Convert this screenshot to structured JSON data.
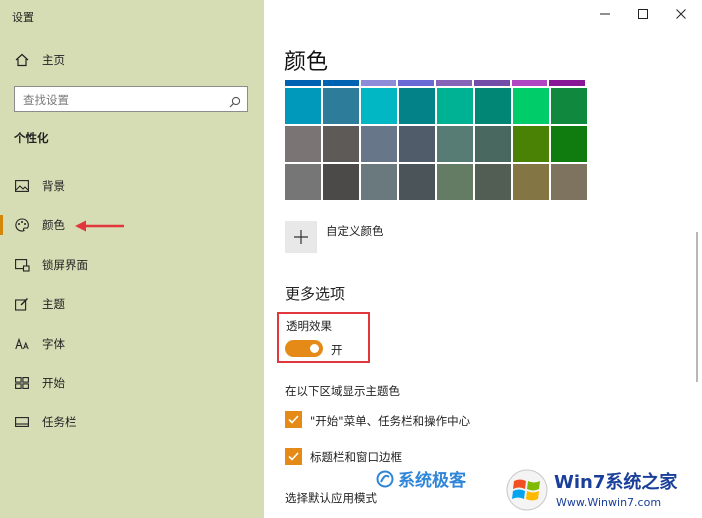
{
  "window": {
    "title": "设置",
    "minimize_glyph": "—",
    "maximize_glyph": "☐",
    "close_glyph": "✕"
  },
  "sidebar": {
    "home_label": "主页",
    "search_placeholder": "查找设置",
    "section": "个性化",
    "items": [
      {
        "label": "背景",
        "icon": "picture-icon"
      },
      {
        "label": "颜色",
        "icon": "palette-icon",
        "selected": true
      },
      {
        "label": "锁屏界面",
        "icon": "lock-screen-icon"
      },
      {
        "label": "主题",
        "icon": "theme-brush-icon"
      },
      {
        "label": "字体",
        "icon": "font-icon"
      },
      {
        "label": "开始",
        "icon": "start-grid-icon"
      },
      {
        "label": "任务栏",
        "icon": "taskbar-icon"
      }
    ]
  },
  "content": {
    "title": "颜色",
    "custom_color_label": "自定义颜色",
    "more_options": "更多选项",
    "transparency_label": "透明效果",
    "transparency_state": "开",
    "show_accent_label": "在以下区域显示主题色",
    "checkbox_start": "\"开始\"菜单、任务栏和操作中心",
    "checkbox_titlebar": "标题栏和窗口边框",
    "choose_mode_label": "选择默认应用模式"
  },
  "swatch_strip": [
    "#0063b1",
    "#0063b1",
    "#8e8cd8",
    "#6b69d6",
    "#8764b8",
    "#744da9",
    "#b146c2",
    "#881798"
  ],
  "swatch_grid": [
    [
      "#0099bc",
      "#2d7d9a",
      "#00b7c3",
      "#038387",
      "#00b294",
      "#018574",
      "#00cc6a",
      "#10893e"
    ],
    [
      "#7a7574",
      "#5d5a58",
      "#68768a",
      "#515c6b",
      "#567c73",
      "#486860",
      "#498205",
      "#107c10"
    ],
    [
      "#767676",
      "#4c4a48",
      "#69797e",
      "#4a5459",
      "#647c64",
      "#525e54",
      "#847545",
      "#7e735f"
    ]
  ],
  "colors": {
    "sidebar_bg": "#d6ddb4",
    "accent": "#e58a16",
    "highlight_box": "#e0363c"
  },
  "watermarks": {
    "left": "系统极客",
    "right_title": "Win7系统之家",
    "right_url": "Www.Winwin7.com"
  }
}
